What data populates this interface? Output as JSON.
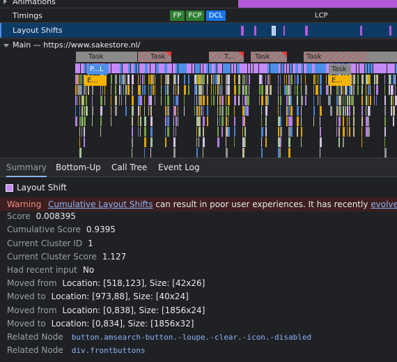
{
  "timeline": {
    "tracks": {
      "animations": "Animations",
      "timings": "Timings",
      "layout_shifts": "Layout Shifts",
      "main": "Main — https://www.sakestore.nl/"
    },
    "timing_marks": {
      "fp": "FP",
      "fcp": "FCP",
      "dcl": "DCL",
      "lcp": "LCP"
    },
    "tasks": [
      "Task",
      "Task",
      "T...",
      "Task",
      "Task",
      "Task"
    ],
    "flame_labels": [
      "P...L",
      "E...",
      "E..."
    ],
    "colors": {
      "fp": "#2e7d32",
      "fcp": "#2e7d32",
      "dcl": "#1a73e8",
      "layout_shift": "#b45ad8",
      "selected_track": "#0e3a66"
    }
  },
  "tabs": [
    "Summary",
    "Bottom-Up",
    "Call Tree",
    "Event Log"
  ],
  "summary": {
    "title": "Layout Shift",
    "warning_label": "Warning",
    "warning_link": "Cumulative Layout Shifts",
    "warning_text": " can result in poor user experiences. It has recently ",
    "warning_link2": "evolved",
    "warning_end": ".",
    "rows": [
      {
        "key": "Score",
        "value": "0.008395"
      },
      {
        "key": "Cumulative Score",
        "value": "0.9395"
      },
      {
        "key": "Current Cluster ID",
        "value": "1"
      },
      {
        "key": "Current Cluster Score",
        "value": "1.127"
      },
      {
        "key": "Had recent input",
        "value": "No"
      },
      {
        "key": "Moved from",
        "value": "Location: [518,123], Size: [42x26]"
      },
      {
        "key": "Moved to",
        "value": "Location: [973,88], Size: [40x24]"
      },
      {
        "key": "Moved from",
        "value": "Location: [0,838], Size: [1856x24]"
      },
      {
        "key": "Moved to",
        "value": "Location: [0,834], Size: [1856x32]"
      },
      {
        "key": "Related Node",
        "value": "button.amsearch-button.-loupe.-clear.-icon.-disabled"
      },
      {
        "key": "Related Node",
        "value": "div.frontbuttons"
      }
    ]
  }
}
